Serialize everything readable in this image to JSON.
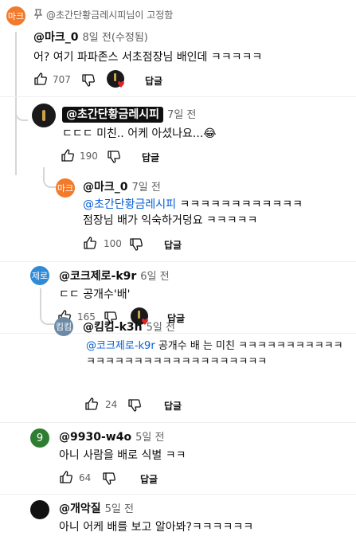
{
  "pinned": {
    "label": "@초간단황금레시피님이 고정함",
    "icon": "pin-icon"
  },
  "comments": [
    {
      "avatar_text": "마크",
      "avatar_color": "#f27a2a",
      "handle": "@마크_0",
      "time": "8일 전(수정됨)",
      "text": "어? 여기 파파존스 서초점장님 배인데 ㅋㅋㅋㅋㅋ",
      "likes": "707",
      "reply_label": "답글"
    },
    {
      "avatar_text": "",
      "avatar_color": "#1a1a1a",
      "handle": "@초간단황금레시피",
      "time": "7일 전",
      "text": "ㄷㄷㄷ 미친.. 어케 아셨나요...😂",
      "likes": "190",
      "reply_label": "답글"
    },
    {
      "avatar_text": "마크",
      "avatar_color": "#f27a2a",
      "handle": "@마크_0",
      "time": "7일 전",
      "mention": "@초간단황금레시피",
      "text_after_mention": " ㅋㅋㅋㅋㅋㅋㅋㅋㅋㅋㅋㅋ",
      "text_line2": "점장님 배가 익숙하거덩요 ㅋㅋㅋㅋㅋ",
      "likes": "100",
      "reply_label": "답글"
    },
    {
      "avatar_text": "제로",
      "avatar_color": "#2f8bd8",
      "handle": "@코크제로-k9r",
      "time": "6일 전",
      "text": "ㄷㄷ 공개수'배'",
      "likes": "165",
      "reply_label": "답글"
    },
    {
      "avatar_text": "킴킴",
      "avatar_color": "#6c8aa6",
      "handle": "@킴킴-k3h",
      "time": "5일 전",
      "mention": "@코크제로-k9r",
      "text_after_mention": "  공개수 배 는 미친 ㅋㅋㅋㅋㅋㅋㅋㅋㅋㅋㅋ",
      "text_line2": "ㅋㅋㅋㅋㅋㅋㅋㅋㅋㅋㅋㅋㅋㅋㅋㅋㅋㅋㅋ",
      "likes": "24",
      "reply_label": "답글"
    },
    {
      "avatar_text": "9",
      "avatar_color": "#2e7d32",
      "handle": "@9930-w4o",
      "time": "5일 전",
      "text": "아니 사람을 배로 식별 ㅋㅋ",
      "likes": "64",
      "reply_label": "답글"
    },
    {
      "avatar_text": "",
      "avatar_color": "#111111",
      "handle": "@개악질",
      "time": "5일 전",
      "text": "아니 어케 배를 보고 알아봐?ㅋㅋㅋㅋㅋㅋ"
    }
  ]
}
